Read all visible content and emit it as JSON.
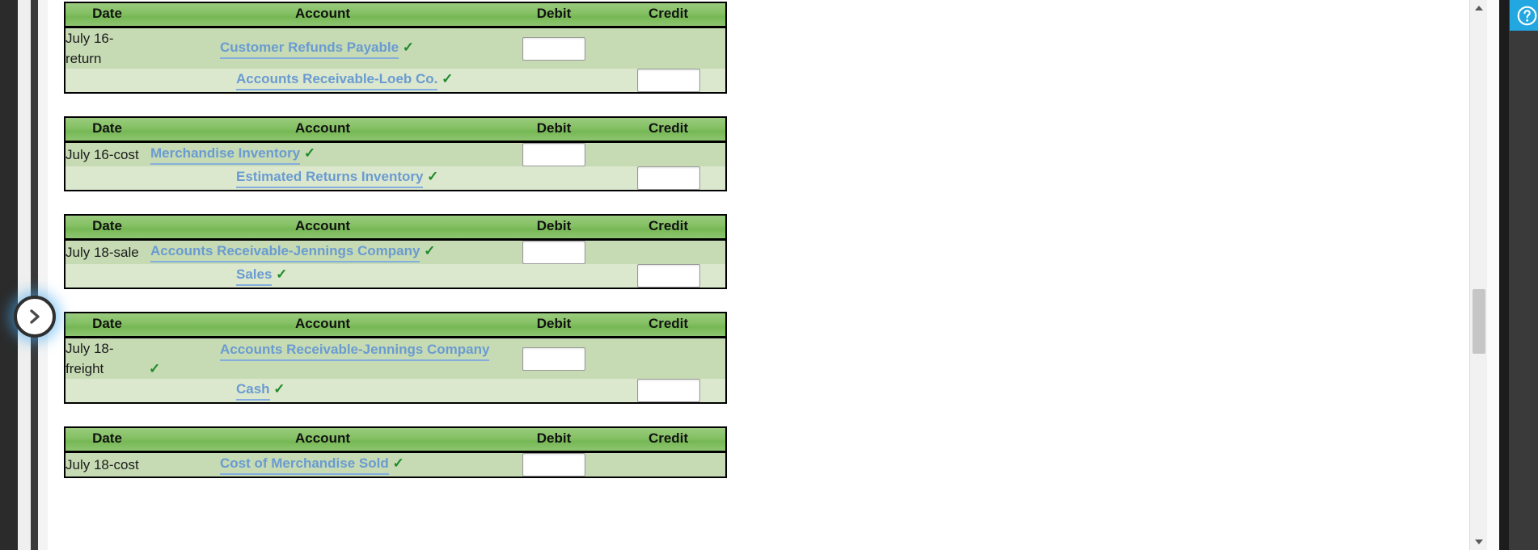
{
  "columns": {
    "date": "Date",
    "account": "Account",
    "debit": "Debit",
    "credit": "Credit"
  },
  "icons": {
    "pane_toggle": "chevron-right-icon",
    "help": "question-mark-circle-icon",
    "check": "green-check-icon",
    "scroll_up": "triangle-up-icon",
    "scroll_down": "triangle-down-icon"
  },
  "colors": {
    "header_green": "#84c063",
    "row_dark": "#c6dbb4",
    "row_light": "#dce8cd",
    "link_blue": "#6a9bd1",
    "check_green": "#1f8a2a",
    "help_blue": "#22a7e0"
  },
  "entries": [
    {
      "id": "entry-1",
      "rows": [
        {
          "date": "July 16-return",
          "account": "Customer Refunds Payable",
          "checked": true,
          "indent": 1,
          "amount_side": "debit",
          "amount": ""
        },
        {
          "date": "",
          "account": "Accounts Receivable-Loeb Co.",
          "checked": true,
          "indent": 2,
          "amount_side": "credit",
          "amount": ""
        }
      ]
    },
    {
      "id": "entry-2",
      "rows": [
        {
          "date": "July 16-cost",
          "account": "Merchandise Inventory",
          "checked": true,
          "indent": 0,
          "amount_side": "debit",
          "amount": ""
        },
        {
          "date": "",
          "account": "Estimated Returns Inventory",
          "checked": true,
          "indent": 2,
          "amount_side": "credit",
          "amount": ""
        }
      ]
    },
    {
      "id": "entry-3",
      "rows": [
        {
          "date": "July 18-sale",
          "account": "Accounts Receivable-Jennings Company",
          "checked": true,
          "indent": 0,
          "amount_side": "debit",
          "amount": ""
        },
        {
          "date": "",
          "account": "Sales",
          "checked": true,
          "indent": 2,
          "amount_side": "credit",
          "amount": ""
        }
      ]
    },
    {
      "id": "entry-4",
      "rows": [
        {
          "date": "July 18-freight",
          "account": "Accounts Receivable-Jennings Company",
          "checked": true,
          "indent": 1,
          "amount_side": "debit",
          "amount": ""
        },
        {
          "date": "",
          "account": "Cash",
          "checked": true,
          "indent": 2,
          "amount_side": "credit",
          "amount": ""
        }
      ]
    },
    {
      "id": "entry-5",
      "rows": [
        {
          "date": "July 18-cost",
          "account": "Cost of Merchandise Sold",
          "checked": true,
          "indent": 1,
          "amount_side": "debit",
          "amount": ""
        }
      ]
    }
  ]
}
